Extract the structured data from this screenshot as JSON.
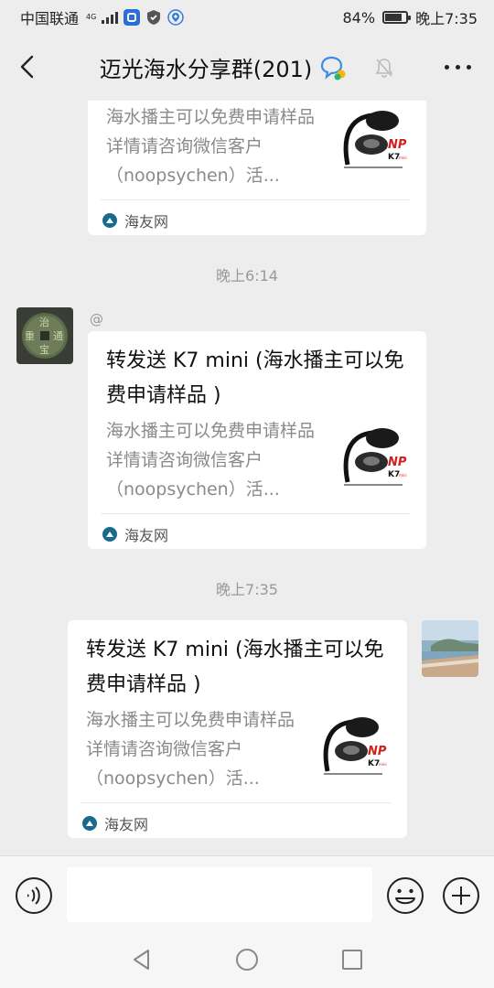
{
  "status_bar": {
    "carrier": "中国联通",
    "network": "4G",
    "battery_percent": "84%",
    "time": "晚上7:35",
    "battery_level": 0.84
  },
  "header": {
    "title": "迈光海水分享群(201)",
    "back_icon": "chevron-left-icon",
    "more_icon": "more-dots-icon"
  },
  "messages": [
    {
      "type": "card_partial",
      "description": "海水播主可以免费申请样品详情请咨询微信客户（noopsychen）活...",
      "source": "海友网"
    },
    {
      "type": "timestamp",
      "text": "晚上6:14"
    },
    {
      "type": "card_incoming",
      "sender_label": "@",
      "title": "转发送 K7 mini (海水播主可以免费申请样品 )",
      "description": "海水播主可以免费申请样品详情请咨询微信客户（noopsychen）活...",
      "source": "海友网"
    },
    {
      "type": "timestamp",
      "text": "晚上7:35"
    },
    {
      "type": "card_outgoing",
      "title": "转发送 K7 mini (海水播主可以免费申请样品 )",
      "description": "海水播主可以免费申请样品详情请咨询微信客户（noopsychen）活...",
      "source": "海友网"
    }
  ],
  "input_bar": {
    "input_value": "",
    "voice_icon": "voice-icon",
    "emoji_icon": "emoji-icon",
    "plus_icon": "plus-icon"
  },
  "thumbnail": {
    "brand": "NP",
    "model": "K7",
    "model_sub": "mini"
  },
  "colors": {
    "background": "#ededed",
    "card": "#ffffff",
    "muted_text": "#8a8a8a",
    "brand_red": "#d0211c"
  }
}
